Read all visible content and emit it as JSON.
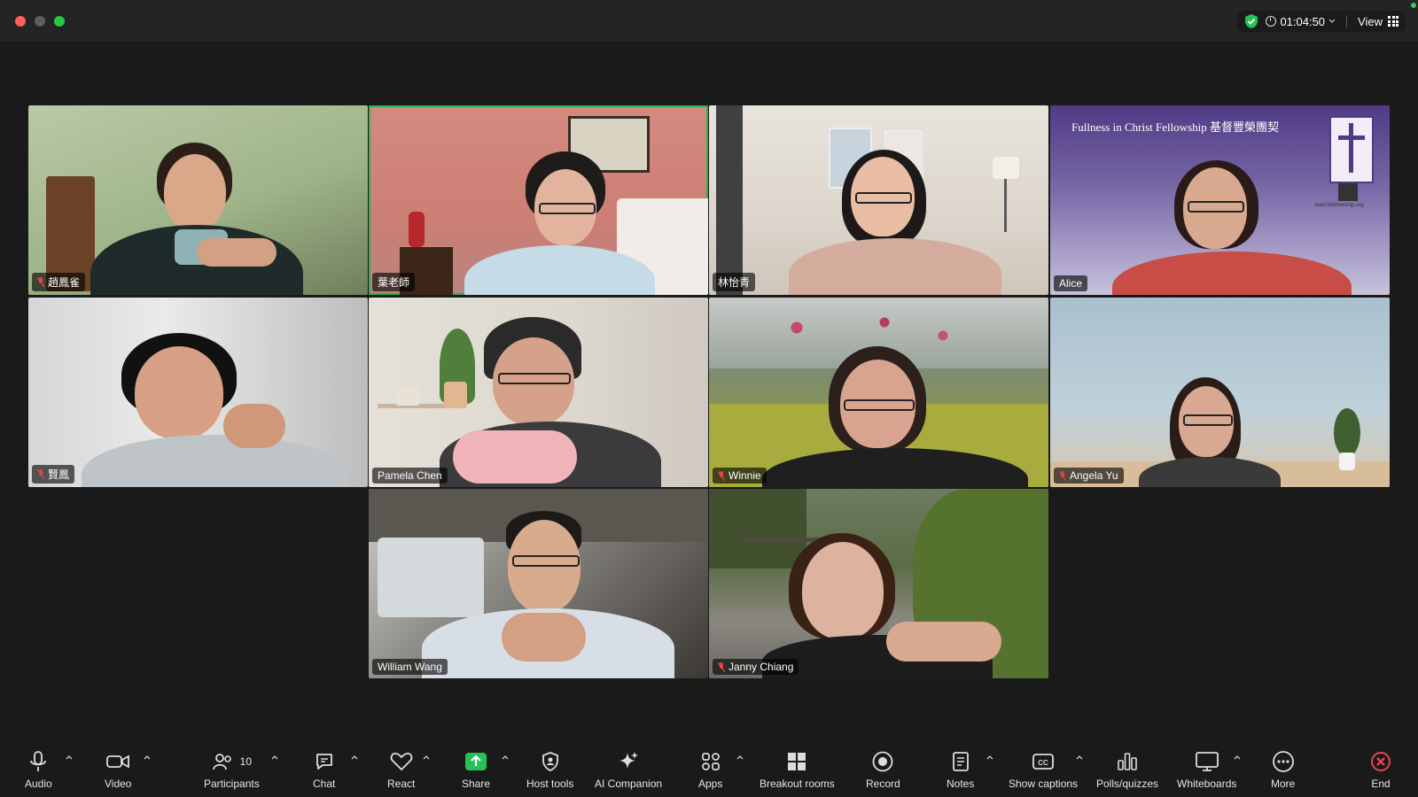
{
  "titlebar": {
    "timer": "01:04:50",
    "view_label": "View"
  },
  "participants": [
    {
      "name": "趙鳳雀",
      "muted": true
    },
    {
      "name": "葉老師",
      "muted": false,
      "speaking": true
    },
    {
      "name": "林怡青",
      "muted": false
    },
    {
      "name": "Alice",
      "muted": false
    },
    {
      "name": "賢鳳",
      "muted": true
    },
    {
      "name": "Pamela Chen",
      "muted": false
    },
    {
      "name": "Winnie",
      "muted": true
    },
    {
      "name": "Angela Yu",
      "muted": true
    },
    {
      "name": "William Wang",
      "muted": false
    },
    {
      "name": "Janny Chiang",
      "muted": true
    }
  ],
  "banner": {
    "text": "Fullness in Christ Fellowship 基督豐榮團契",
    "url": "www.fcfellowship.org"
  },
  "toolbar": {
    "audio": "Audio",
    "video": "Video",
    "participants": "Participants",
    "participants_count": "10",
    "chat": "Chat",
    "react": "React",
    "share": "Share",
    "host_tools": "Host tools",
    "ai_companion": "AI Companion",
    "apps": "Apps",
    "breakout_rooms": "Breakout rooms",
    "record": "Record",
    "notes": "Notes",
    "show_captions": "Show captions",
    "polls": "Polls/quizzes",
    "whiteboards": "Whiteboards",
    "more": "More",
    "end": "End"
  },
  "colors": {
    "share_green": "#24c15a",
    "end_red": "#e5474e",
    "speaking_border": "#2ab34a"
  }
}
